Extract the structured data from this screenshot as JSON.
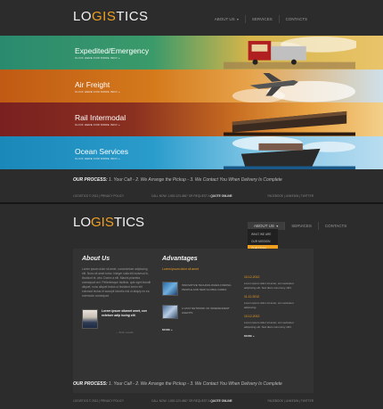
{
  "logo": {
    "left": "LO",
    "mid": "GIS",
    "right": "TICS"
  },
  "nav": {
    "about": "About us",
    "services": "Services",
    "contacts": "Contacts",
    "caret": "▾"
  },
  "banners": [
    {
      "title": "Expedited/Emergency",
      "sub": "CLICK HERE FOR MORE INFO »"
    },
    {
      "title": "Air Freight",
      "sub": "CLICK HERE FOR MORE INFO »"
    },
    {
      "title": "Rail Intermodal",
      "sub": "CLICK HERE FOR MORE INFO »"
    },
    {
      "title": "Ocean Services",
      "sub": "CLICK HERE FOR MORE INFO »"
    }
  ],
  "process": {
    "label": "OUR PROCESS:",
    "text": " 1. Your Call - 2. We Arrange the Pickup - 3. We Contact You When Delivery Is Complete"
  },
  "footer": {
    "copy": "LOGISTICS © 2012 | PRIVACY POLICY",
    "contact": "CALL NOW: 1-800-123-4567 OR REQUEST A ",
    "quote": "QUOTE ONLINE",
    "social": "FACEBOOK | LINKEDIN | TWITTER"
  },
  "dropdown": [
    "What we are",
    "Our mission",
    "Our team",
    "FAQs"
  ],
  "about": {
    "heading": "About Us",
    "text": "Lorem ipsum dolor sit amet, consectetuer adipiscing elit. Nunc sit amet tortor. Integer nulla elit euismod in, tincidunt et, wisi. Donec a elit. Mauris pharetra consequat orci. Pellentesque facilisis, quis eget blandit aliquet, nunc aliquet lectus ut tincidunt lorem elit euismod lectus et suscipit lobortis nisl ut aliquip ex ea commodo consequat.",
    "quote": "Lorem ipsum sitamet amet, con ectetuer adip iscing elit.",
    "author": "— Brian Lasalle"
  },
  "advantages": {
    "heading": "Advantages",
    "lead": "Lorem ipsum dolor sit amet",
    "items": [
      "Innovative technologies finding people and new global fares",
      "A vast network of independent agents"
    ],
    "more": "MORE »"
  },
  "news": [
    {
      "date": "10-12-2012",
      "text": "Lorem ipsum dolor sit amet, con sectetuer adipiscing elit. Sed diam nonummy nibh."
    },
    {
      "date": "11-12-2012",
      "text": "Lorem ipsum dolor sit amet, con sectetuer adipiscing."
    },
    {
      "date": "10-12-2012",
      "text": "Lorem ipsum dolor sit amet, con sectetuer adipiscing elit. Sed diam nonummy nibh."
    }
  ],
  "news_more": "MORE »"
}
